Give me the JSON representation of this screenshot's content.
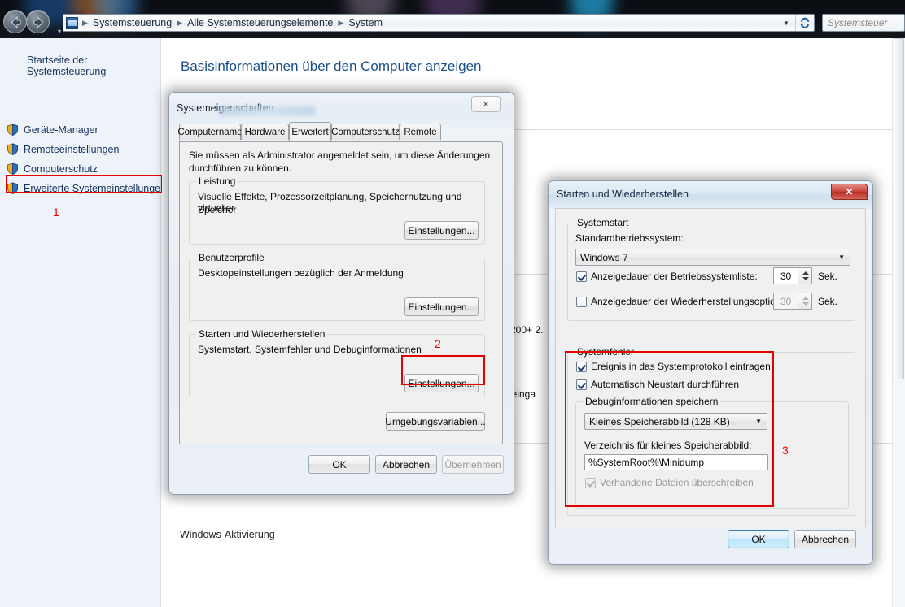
{
  "explorer": {
    "nav": {
      "back": "back-arrow",
      "forward": "forward-arrow",
      "dropdown": "▾"
    },
    "address": {
      "icon": "control-panel-icon",
      "crumbs": [
        "Systemsteuerung",
        "Alle Systemsteuerungselemente",
        "System"
      ],
      "separator": "▶",
      "caret": "▼",
      "refresh": "refresh-icon"
    },
    "search": {
      "placeholder": "Systemsteuer"
    }
  },
  "sidebar": {
    "home": "Startseite der Systemsteuerung",
    "items": [
      {
        "label": "Geräte-Manager"
      },
      {
        "label": "Remoteeinstellungen"
      },
      {
        "label": "Computerschutz"
      },
      {
        "label": "Erweiterte Systemeinstellungen"
      }
    ],
    "annotation": "1"
  },
  "main": {
    "title": "Basisinformationen über den Computer anzeigen",
    "sections": [
      {
        "label": "Windows-Edition"
      },
      {
        "label": "Windows-Aktivierung"
      }
    ],
    "fragments": [
      {
        "text": "200+  2."
      },
      {
        "text": "ereinga"
      },
      {
        "text": "W"
      }
    ]
  },
  "system_properties": {
    "title": "Systemeigenschaften",
    "close_label": "✕",
    "tabs": [
      {
        "label": "Computername",
        "active": false
      },
      {
        "label": "Hardware",
        "active": false
      },
      {
        "label": "Erweitert",
        "active": true
      },
      {
        "label": "Computerschutz",
        "active": false
      },
      {
        "label": "Remote",
        "active": false
      }
    ],
    "admin_note_line1": "Sie müssen als Administrator angemeldet sein, um diese Änderungen",
    "admin_note_line2": "durchführen zu können.",
    "groups": {
      "performance": {
        "label": "Leistung",
        "desc_line1": "Visuelle Effekte, Prozessorzeitplanung, Speichernutzung und virtueller",
        "desc_line2": "Speicher",
        "button": "Einstellungen..."
      },
      "user_profiles": {
        "label": "Benutzerprofile",
        "desc": "Desktopeinstellungen bezüglich der Anmeldung",
        "button": "Einstellungen..."
      },
      "startup_recovery": {
        "label": "Starten und Wiederherstellen",
        "desc": "Systemstart, Systemfehler und Debuginformationen",
        "button": "Einstellungen...",
        "annotation": "2"
      }
    },
    "env_button": "Umgebungsvariablen...",
    "footer": {
      "ok": "OK",
      "cancel": "Abbrechen",
      "apply": "Übernehmen"
    }
  },
  "startup_recovery_dialog": {
    "title": "Starten und Wiederherstellen",
    "close_label": "✕",
    "annotation": "3",
    "startup": {
      "label": "Systemstart",
      "default_os_label": "Standardbetriebssystem:",
      "default_os_value": "Windows 7",
      "os_list_timeout": {
        "label": "Anzeigedauer der Betriebssystemliste:",
        "checked": true,
        "value": "30",
        "unit": "Sek."
      },
      "recovery_timeout": {
        "label": "Anzeigedauer der Wiederherstellungsoptionen:",
        "checked": false,
        "value": "30",
        "unit": "Sek."
      }
    },
    "system_failure": {
      "label": "Systemfehler",
      "write_event": {
        "label": "Ereignis in das Systemprotokoll eintragen",
        "checked": true
      },
      "auto_restart": {
        "label": "Automatisch Neustart durchführen",
        "checked": true
      },
      "debug_info": {
        "label": "Debuginformationen speichern",
        "dump_type": "Kleines Speicherabbild (128 KB)",
        "dump_dir_label": "Verzeichnis für kleines Speicherabbild:",
        "dump_dir_value": "%SystemRoot%\\Minidump",
        "overwrite": {
          "label": "Vorhandene Dateien überschreiben",
          "checked": true,
          "disabled": true
        }
      }
    },
    "footer": {
      "ok": "OK",
      "cancel": "Abbrechen"
    }
  }
}
